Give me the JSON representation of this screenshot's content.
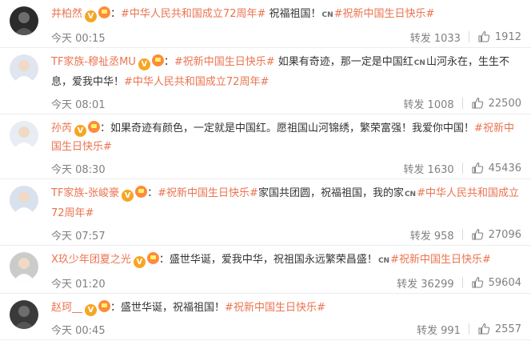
{
  "posts": [
    {
      "author": "井柏然",
      "colon": "：",
      "segments": [
        {
          "t": "topic",
          "v": "#中华人民共和国成立72周年#"
        },
        {
          "t": "text",
          "v": " 祝福祖国！"
        },
        {
          "t": "cn",
          "v": "CN"
        },
        {
          "t": "topic",
          "v": "#祝新中国生日快乐#"
        }
      ],
      "time": "今天 00:15",
      "repost_label": "转发 1033",
      "likes": "1912"
    },
    {
      "author": "TF家族-穆祉丞MU",
      "colon": "：",
      "segments": [
        {
          "t": "topic",
          "v": "#祝新中国生日快乐#"
        },
        {
          "t": "text",
          "v": " 如果有奇迹，那一定是中国红"
        },
        {
          "t": "cn",
          "v": "CN"
        },
        {
          "t": "text",
          "v": "山河永在，生生不息，爱我中华！"
        },
        {
          "t": "topic",
          "v": "#中华人民共和国成立72周年#"
        }
      ],
      "time": "今天 08:01",
      "repost_label": "转发 1008",
      "likes": "22500"
    },
    {
      "author": "孙芮",
      "colon": "：",
      "segments": [
        {
          "t": "text",
          "v": "如果奇迹有颜色，一定就是中国红。愿祖国山河锦绣，繁荣富强！我爱你中国！"
        },
        {
          "t": "topic",
          "v": "#祝新中国生日快乐#"
        }
      ],
      "time": "今天 08:30",
      "repost_label": "转发 1630",
      "likes": "45436"
    },
    {
      "author": "TF家族-张峻豪",
      "colon": "：",
      "segments": [
        {
          "t": "topic",
          "v": "#祝新中国生日快乐#"
        },
        {
          "t": "text",
          "v": "家国共团圆，祝福祖国，我的家"
        },
        {
          "t": "cn",
          "v": "CN"
        },
        {
          "t": "topic",
          "v": "#中华人民共和国成立72周年#"
        }
      ],
      "time": "今天 07:57",
      "repost_label": "转发 958",
      "likes": "27096"
    },
    {
      "author": "X玖少年团夏之光",
      "colon": "：",
      "segments": [
        {
          "t": "text",
          "v": "盛世华诞，爱我中华，祝祖国永远繁荣昌盛！"
        },
        {
          "t": "cn",
          "v": "CN"
        },
        {
          "t": "topic",
          "v": "#祝新中国生日快乐#"
        }
      ],
      "time": "今天 01:20",
      "repost_label": "转发 36299",
      "likes": "59604"
    },
    {
      "author": "赵珂__",
      "colon": "：",
      "segments": [
        {
          "t": "text",
          "v": "盛世华诞，祝福祖国！"
        },
        {
          "t": "topic",
          "v": "#祝新中国生日快乐#"
        }
      ],
      "time": "今天 00:45",
      "repost_label": "转发 991",
      "likes": "2557"
    }
  ],
  "colors": {
    "link": "#eb7350",
    "meta": "#808080",
    "badge_v": "#f5a623",
    "badge_crown": "#ff8a3d"
  },
  "icons": {
    "verified": "verified-v-icon",
    "member": "vip-crown-icon",
    "like": "thumbs-up-icon",
    "cn": "cn-flag-icon"
  },
  "avatars": [
    "#2b2b2b",
    "#dfe6ef",
    "#e8edf3",
    "#d7e2ee",
    "#c9ccc8",
    "#3a3a3a"
  ]
}
